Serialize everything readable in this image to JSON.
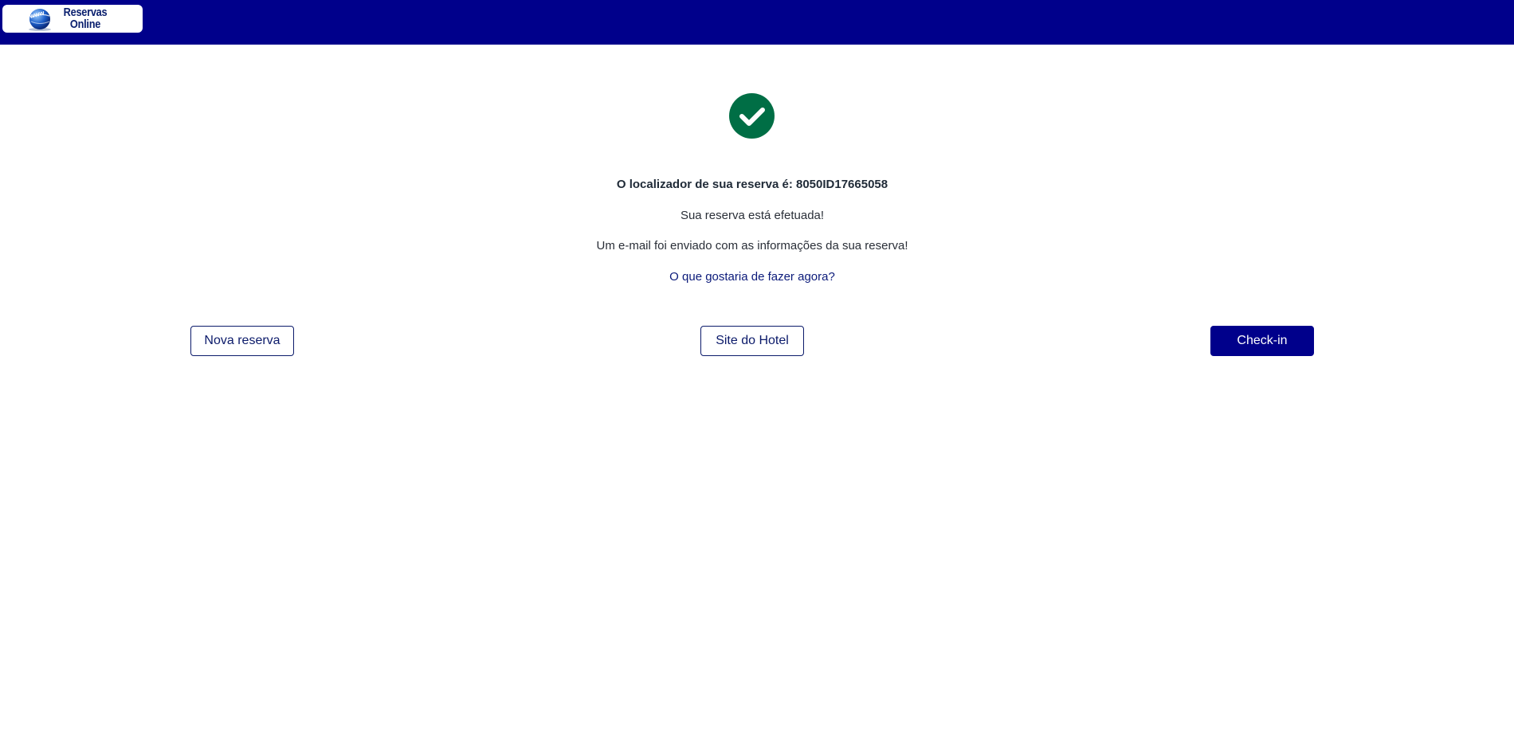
{
  "header": {
    "logo_line1": "Reservas",
    "logo_line2": "Online",
    "background_color": "#00008b"
  },
  "confirmation": {
    "icon": "check-circle-icon",
    "icon_color": "#006e45",
    "locator_text": "O localizador de sua reserva é: 8050ID17665058",
    "done_text": "Sua reserva está efetuada!",
    "email_text": "Um e-mail foi enviado com as informações da sua reserva!",
    "question_text": "O que gostaria de fazer agora?"
  },
  "actions": {
    "new_booking_label": "Nova reserva",
    "hotel_site_label": "Site do Hotel",
    "checkin_label": "Check-in"
  }
}
